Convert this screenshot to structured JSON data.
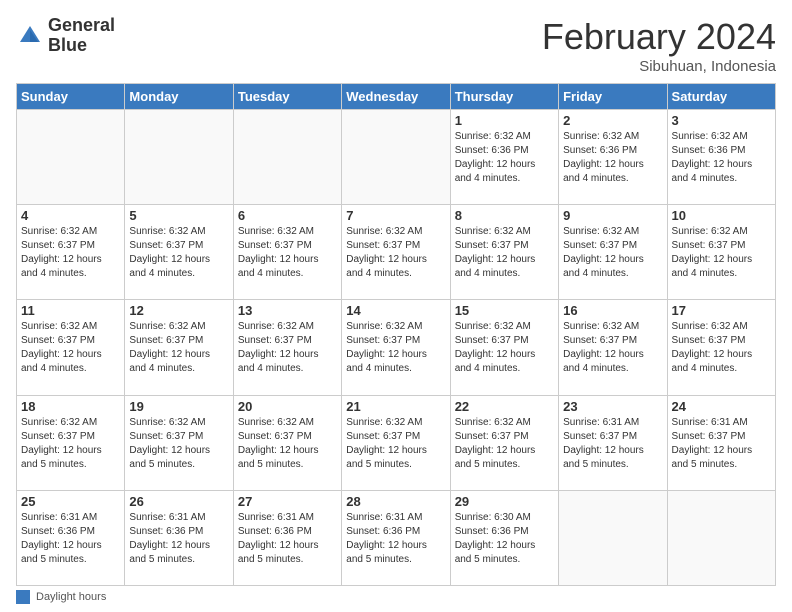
{
  "logo": {
    "line1": "General",
    "line2": "Blue"
  },
  "header": {
    "month": "February 2024",
    "location": "Sibuhuan, Indonesia"
  },
  "weekdays": [
    "Sunday",
    "Monday",
    "Tuesday",
    "Wednesday",
    "Thursday",
    "Friday",
    "Saturday"
  ],
  "footer": {
    "label": "Daylight hours"
  },
  "weeks": [
    [
      {
        "day": "",
        "info": ""
      },
      {
        "day": "",
        "info": ""
      },
      {
        "day": "",
        "info": ""
      },
      {
        "day": "",
        "info": ""
      },
      {
        "day": "1",
        "info": "Sunrise: 6:32 AM\nSunset: 6:36 PM\nDaylight: 12 hours\nand 4 minutes."
      },
      {
        "day": "2",
        "info": "Sunrise: 6:32 AM\nSunset: 6:36 PM\nDaylight: 12 hours\nand 4 minutes."
      },
      {
        "day": "3",
        "info": "Sunrise: 6:32 AM\nSunset: 6:36 PM\nDaylight: 12 hours\nand 4 minutes."
      }
    ],
    [
      {
        "day": "4",
        "info": "Sunrise: 6:32 AM\nSunset: 6:37 PM\nDaylight: 12 hours\nand 4 minutes."
      },
      {
        "day": "5",
        "info": "Sunrise: 6:32 AM\nSunset: 6:37 PM\nDaylight: 12 hours\nand 4 minutes."
      },
      {
        "day": "6",
        "info": "Sunrise: 6:32 AM\nSunset: 6:37 PM\nDaylight: 12 hours\nand 4 minutes."
      },
      {
        "day": "7",
        "info": "Sunrise: 6:32 AM\nSunset: 6:37 PM\nDaylight: 12 hours\nand 4 minutes."
      },
      {
        "day": "8",
        "info": "Sunrise: 6:32 AM\nSunset: 6:37 PM\nDaylight: 12 hours\nand 4 minutes."
      },
      {
        "day": "9",
        "info": "Sunrise: 6:32 AM\nSunset: 6:37 PM\nDaylight: 12 hours\nand 4 minutes."
      },
      {
        "day": "10",
        "info": "Sunrise: 6:32 AM\nSunset: 6:37 PM\nDaylight: 12 hours\nand 4 minutes."
      }
    ],
    [
      {
        "day": "11",
        "info": "Sunrise: 6:32 AM\nSunset: 6:37 PM\nDaylight: 12 hours\nand 4 minutes."
      },
      {
        "day": "12",
        "info": "Sunrise: 6:32 AM\nSunset: 6:37 PM\nDaylight: 12 hours\nand 4 minutes."
      },
      {
        "day": "13",
        "info": "Sunrise: 6:32 AM\nSunset: 6:37 PM\nDaylight: 12 hours\nand 4 minutes."
      },
      {
        "day": "14",
        "info": "Sunrise: 6:32 AM\nSunset: 6:37 PM\nDaylight: 12 hours\nand 4 minutes."
      },
      {
        "day": "15",
        "info": "Sunrise: 6:32 AM\nSunset: 6:37 PM\nDaylight: 12 hours\nand 4 minutes."
      },
      {
        "day": "16",
        "info": "Sunrise: 6:32 AM\nSunset: 6:37 PM\nDaylight: 12 hours\nand 4 minutes."
      },
      {
        "day": "17",
        "info": "Sunrise: 6:32 AM\nSunset: 6:37 PM\nDaylight: 12 hours\nand 4 minutes."
      }
    ],
    [
      {
        "day": "18",
        "info": "Sunrise: 6:32 AM\nSunset: 6:37 PM\nDaylight: 12 hours\nand 5 minutes."
      },
      {
        "day": "19",
        "info": "Sunrise: 6:32 AM\nSunset: 6:37 PM\nDaylight: 12 hours\nand 5 minutes."
      },
      {
        "day": "20",
        "info": "Sunrise: 6:32 AM\nSunset: 6:37 PM\nDaylight: 12 hours\nand 5 minutes."
      },
      {
        "day": "21",
        "info": "Sunrise: 6:32 AM\nSunset: 6:37 PM\nDaylight: 12 hours\nand 5 minutes."
      },
      {
        "day": "22",
        "info": "Sunrise: 6:32 AM\nSunset: 6:37 PM\nDaylight: 12 hours\nand 5 minutes."
      },
      {
        "day": "23",
        "info": "Sunrise: 6:31 AM\nSunset: 6:37 PM\nDaylight: 12 hours\nand 5 minutes."
      },
      {
        "day": "24",
        "info": "Sunrise: 6:31 AM\nSunset: 6:37 PM\nDaylight: 12 hours\nand 5 minutes."
      }
    ],
    [
      {
        "day": "25",
        "info": "Sunrise: 6:31 AM\nSunset: 6:36 PM\nDaylight: 12 hours\nand 5 minutes."
      },
      {
        "day": "26",
        "info": "Sunrise: 6:31 AM\nSunset: 6:36 PM\nDaylight: 12 hours\nand 5 minutes."
      },
      {
        "day": "27",
        "info": "Sunrise: 6:31 AM\nSunset: 6:36 PM\nDaylight: 12 hours\nand 5 minutes."
      },
      {
        "day": "28",
        "info": "Sunrise: 6:31 AM\nSunset: 6:36 PM\nDaylight: 12 hours\nand 5 minutes."
      },
      {
        "day": "29",
        "info": "Sunrise: 6:30 AM\nSunset: 6:36 PM\nDaylight: 12 hours\nand 5 minutes."
      },
      {
        "day": "",
        "info": ""
      },
      {
        "day": "",
        "info": ""
      }
    ]
  ]
}
